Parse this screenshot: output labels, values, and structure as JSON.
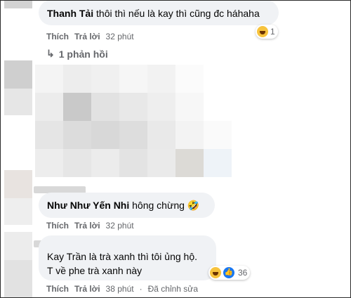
{
  "comments": [
    {
      "author": "Thanh Tải",
      "text": "thôi thì nếu là kay thì cũng đc háhaha",
      "actions": {
        "like": "Thích",
        "reply": "Trả lời",
        "time": "32 phút"
      },
      "reaction": {
        "icons": [
          "haha"
        ],
        "count": "1"
      }
    },
    {
      "author": "Như Như Yến Nhi",
      "text": "hông chừng 🤣",
      "actions": {
        "like": "Thích",
        "reply": "Trả lời",
        "time": "32 phút"
      }
    },
    {
      "author": "",
      "text_line1": "Kay Trần là trà xanh thì tôi ủng hộ.",
      "text_line2": "T về phe trà xanh này",
      "actions": {
        "like": "Thích",
        "reply": "Trả lời",
        "time": "38 phút",
        "edited": "Đã chỉnh sửa"
      },
      "reaction": {
        "icons": [
          "haha",
          "like"
        ],
        "count": "36"
      }
    }
  ],
  "replies_link": "1 phản hồi",
  "reply_arrow_icon": "reply-arrow-icon",
  "colors": {
    "bubble": "#f0f2f5",
    "meta": "#65676b",
    "like": "#1877f2",
    "haha": "#f7c33d"
  }
}
